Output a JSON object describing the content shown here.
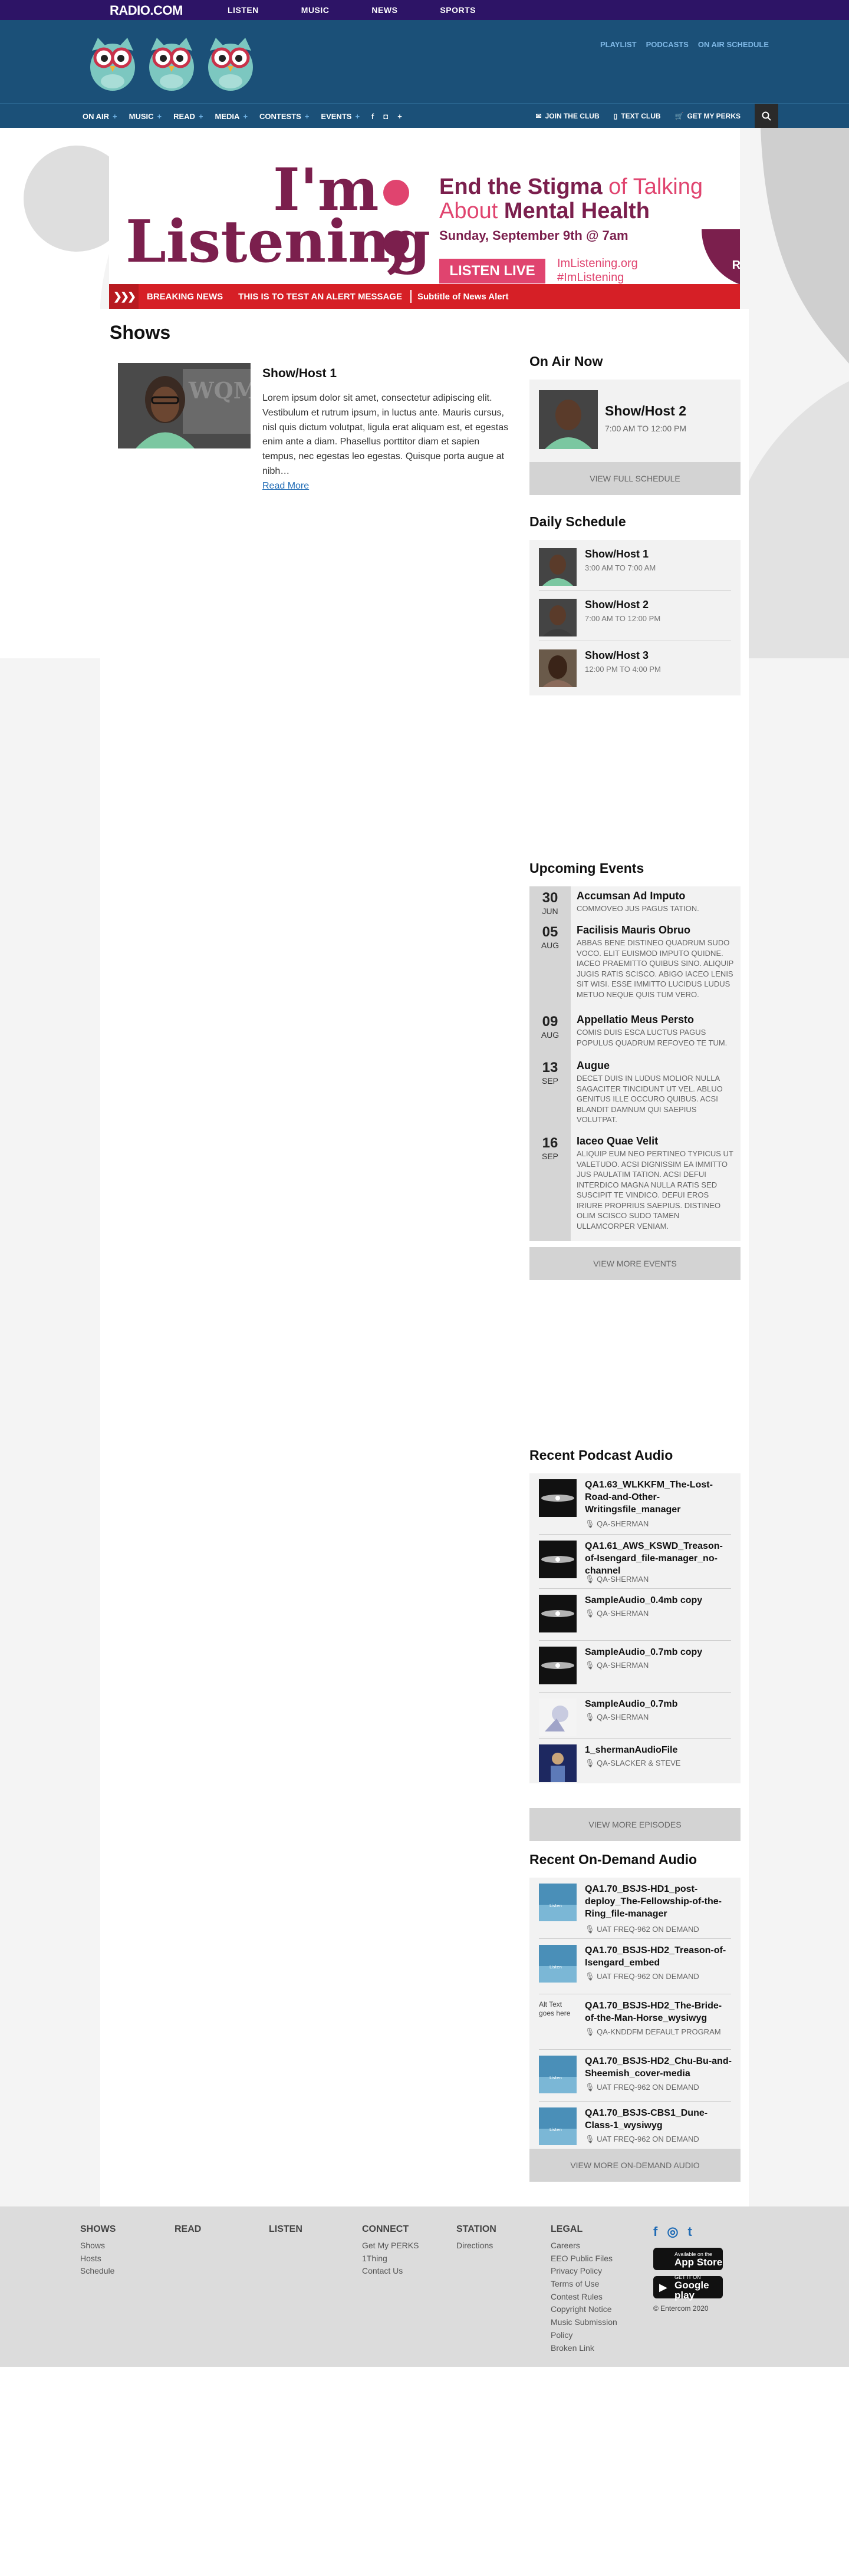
{
  "topbar": {
    "logo": "RADIO.COM",
    "nav": [
      "LISTEN",
      "MUSIC",
      "NEWS",
      "SPORTS"
    ]
  },
  "header": {
    "links": [
      "PLAYLIST",
      "PODCASTS",
      "ON AIR SCHEDULE"
    ]
  },
  "mainnav": {
    "items": [
      "ON AIR",
      "MUSIC",
      "READ",
      "MEDIA",
      "CONTESTS",
      "EVENTS"
    ],
    "social": [
      "f",
      "◘",
      "+"
    ],
    "right_links": [
      "JOIN THE CLUB",
      "TEXT CLUB",
      "GET MY PERKS"
    ]
  },
  "banner": {
    "radio_logo": "RADIO.COM",
    "title_line1": "I'm",
    "title_line2": "Listening",
    "headline_a": "End the Stigma",
    "headline_b": "of Talking About",
    "headline_c": "Mental Health",
    "date": "Sunday, September 9th @ 7am",
    "button": "LISTEN LIVE",
    "url": "ImListening.org",
    "hashtag": "#ImListening"
  },
  "breaking": {
    "label": "BREAKING NEWS",
    "message": "THIS IS TO TEST AN ALERT MESSAGE",
    "subtitle": "Subtitle of News Alert"
  },
  "shows": {
    "title": "Shows",
    "card": {
      "name": "Show/Host 1",
      "description": "Lorem ipsum dolor sit amet, consectetur adipiscing elit. Vestibulum et rutrum ipsum, in luctus ante. Mauris cursus, nisl quis dictum volutpat, ligula erat aliquam est, et egestas enim ante a diam. Phasellus porttitor diam et sapien tempus, nec egestas leo egestas. Quisque porta augue at nibh…",
      "read_more": "Read More"
    }
  },
  "on_air": {
    "heading": "On Air Now",
    "name": "Show/Host 2",
    "time": "7:00 AM TO 12:00 PM",
    "button": "VIEW FULL SCHEDULE"
  },
  "daily_schedule": {
    "heading": "Daily Schedule",
    "items": [
      {
        "name": "Show/Host 1",
        "time": "3:00 AM TO 7:00 AM"
      },
      {
        "name": "Show/Host 2",
        "time": "7:00 AM TO 12:00 PM"
      },
      {
        "name": "Show/Host 3",
        "time": "12:00 PM TO 4:00 PM"
      }
    ]
  },
  "events": {
    "heading": "Upcoming Events",
    "items": [
      {
        "day": "30",
        "month": "JUN",
        "title": "Accumsan Ad Imputo",
        "desc": "COMMOVEO JUS PAGUS TATION."
      },
      {
        "day": "05",
        "month": "AUG",
        "title": "Facilisis Mauris Obruo",
        "desc": "ABBAS BENE DISTINEO QUADRUM SUDO VOCO. ELIT EUISMOD IMPUTO QUIDNE. IACEO PRAEMITTO QUIBUS SINO. ALIQUIP JUGIS RATIS SCISCO. ABIGO IACEO LENIS SIT WISI. ESSE IMMITTO LUCIDUS LUDUS METUO NEQUE QUIS TUM VERO."
      },
      {
        "day": "09",
        "month": "AUG",
        "title": "Appellatio Meus Persto",
        "desc": "COMIS DUIS ESCA LUCTUS PAGUS POPULUS QUADRUM REFOVEO TE TUM."
      },
      {
        "day": "13",
        "month": "SEP",
        "title": "Augue",
        "desc": "DECET DUIS IN LUDUS MOLIOR NULLA SAGACITER TINCIDUNT UT VEL. ABLUO GENITUS ILLE OCCURO QUIBUS. ACSI BLANDIT DAMNUM QUI SAEPIUS VOLUTPAT."
      },
      {
        "day": "16",
        "month": "SEP",
        "title": "Iaceo Quae Velit",
        "desc": "ALIQUIP EUM NEO PERTINEO TYPICUS UT VALETUDO. ACSI DIGNISSIM EA IMMITTO JUS PAULATIM TATION. ACSI DEFUI INTERDICO MAGNA NULLA RATIS SED SUSCIPIT TE VINDICO. DEFUI EROS IRIURE PROPRIUS SAEPIUS. DISTINEO OLIM SCISCO SUDO TAMEN ULLAMCORPER VENIAM."
      }
    ],
    "button": "VIEW MORE EVENTS"
  },
  "podcasts": {
    "heading": "Recent Podcast Audio",
    "items": [
      {
        "title": "QA1.63_WLKKFM_The-Lost-Road-and-Other-Writingsfile_manager",
        "by": "QA-SHERMAN"
      },
      {
        "title": "QA1.61_AWS_KSWD_Treason-of-Isengard_file-manager_no-channel",
        "by": "QA-SHERMAN"
      },
      {
        "title": "SampleAudio_0.4mb copy",
        "by": "QA-SHERMAN"
      },
      {
        "title": "SampleAudio_0.7mb copy",
        "by": "QA-SHERMAN"
      },
      {
        "title": "SampleAudio_0.7mb",
        "by": "QA-SHERMAN"
      },
      {
        "title": "1_shermanAudioFile",
        "by": "QA-SLACKER & STEVE"
      }
    ],
    "button": "VIEW MORE EPISODES"
  },
  "ondemand": {
    "heading": "Recent On-Demand Audio",
    "items": [
      {
        "title": "QA1.70_BSJS-HD1_post-deploy_The-Fellowship-of-the-Ring_file-manager",
        "by": "UAT FREQ-962 ON DEMAND"
      },
      {
        "title": "QA1.70_BSJS-HD2_Treason-of-Isengard_embed",
        "by": "UAT FREQ-962 ON DEMAND"
      },
      {
        "title": "QA1.70_BSJS-HD2_The-Bride-of-the-Man-Horse_wysiwyg",
        "by": "QA-KNDDFM DEFAULT PROGRAM",
        "alt": "Alt Text goes here"
      },
      {
        "title": "QA1.70_BSJS-HD2_Chu-Bu-and-Sheemish_cover-media",
        "by": "UAT FREQ-962 ON DEMAND"
      },
      {
        "title": "QA1.70_BSJS-CBS1_Dune-Class-1_wysiwyg",
        "by": "UAT FREQ-962 ON DEMAND"
      }
    ],
    "button": "VIEW MORE ON-DEMAND AUDIO"
  },
  "footer": {
    "shows": {
      "h": "SHOWS",
      "links": [
        "Shows",
        "Hosts",
        "Schedule"
      ]
    },
    "read": {
      "h": "READ"
    },
    "listen": {
      "h": "LISTEN"
    },
    "connect": {
      "h": "CONNECT",
      "links": [
        "Get My PERKS",
        "1Thing",
        "Contact Us"
      ]
    },
    "station": {
      "h": "STATION",
      "links": [
        "Directions"
      ]
    },
    "legal": {
      "h": "LEGAL",
      "links": [
        "Careers",
        "EEO Public Files",
        "Privacy Policy",
        "Terms of Use",
        "Contest Rules",
        "Copyright Notice",
        "Music Submission Policy",
        "Broken Link"
      ]
    },
    "social": [
      "f",
      "◎",
      "t"
    ],
    "appstore_small": "Available on the",
    "appstore": "App Store",
    "gplay_small": "GET IT ON",
    "gplay": "Google play",
    "copyright": "© Entercom 2020"
  },
  "colors": {
    "topbar": "#2d1466",
    "header": "#1b5078",
    "accent_pink": "#e0446f",
    "accent_plum": "#7b1f4d",
    "breaking_red": "#d61f26"
  }
}
